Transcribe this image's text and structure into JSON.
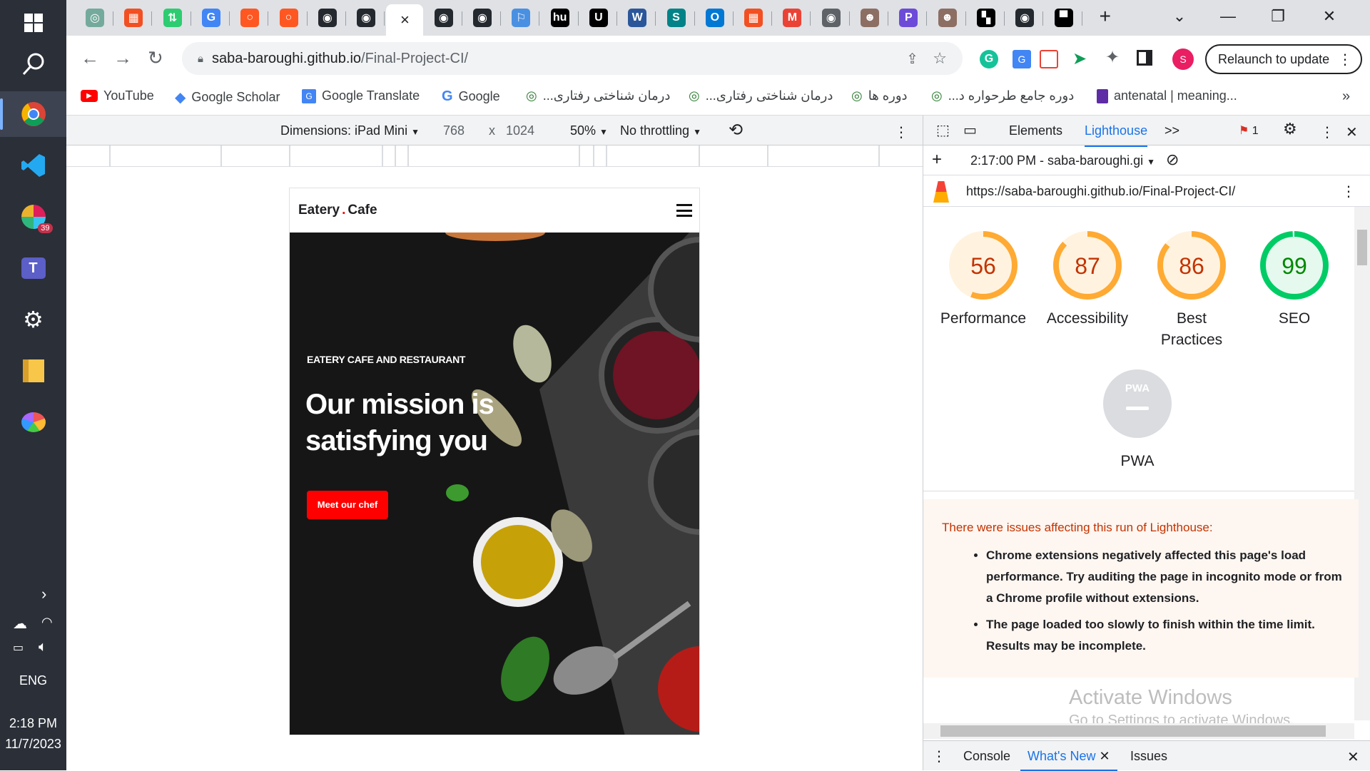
{
  "taskbar": {
    "lang": "ENG",
    "time": "2:18 PM",
    "date": "11/7/2023",
    "slack_badge": "39"
  },
  "tabs": {
    "close_glyph": "×",
    "new_tab": "+",
    "minimize": "—",
    "restore": "❐",
    "close": "✕",
    "favicons": [
      "chatgpt",
      "microsoft",
      "up-down",
      "google-translate",
      "orange-ring",
      "orange-ring",
      "github",
      "github",
      "active",
      "github",
      "github",
      "flag",
      "hu",
      "u",
      "word",
      "sharepoint",
      "outlook",
      "microsoft",
      "gmail",
      "chrome",
      "ninja",
      "p",
      "ninja",
      "bw",
      "github",
      "box"
    ]
  },
  "toolbar": {
    "url_host": "saba-baroughi.github.io",
    "url_path": "/Final-Project-CI/",
    "profile": "S",
    "relaunch": "Relaunch to update"
  },
  "bookmarks": {
    "youtube": "YouTube",
    "scholar": "Google Scholar",
    "translate": "Google Translate",
    "google": "Google",
    "fa1": "درمان شناختی رفتاری...",
    "fa2": "درمان شناختی رفتاری...",
    "fa3": "دوره ها",
    "fa4": "دوره جامع طرحواره د...",
    "antenatal": "antenatal | meaning...",
    "more": "»"
  },
  "device": {
    "dimensions": "Dimensions: iPad Mini",
    "width": "768",
    "x": "x",
    "height": "1024",
    "zoom": "50%",
    "throttling": "No throttling"
  },
  "site": {
    "brand_a": "Eatery",
    "brand_dot": ".",
    "brand_b": "Cafe",
    "eyebrow": "EATERY CAFE AND RESTAURANT",
    "headline_1": "Our mission is",
    "headline_2": "satisfying you",
    "cta": "Meet our chef"
  },
  "devtools": {
    "elements": "Elements",
    "lighthouse": "Lighthouse",
    "more": ">>",
    "issues_count": "1",
    "session": "2:17:00 PM - saba-baroughi.gi",
    "report_url": "https://saba-baroughi.github.io/Final-Project-CI/"
  },
  "scores": [
    {
      "value": 56,
      "label": "Performance",
      "color": "#fa3"
    },
    {
      "value": 87,
      "label": "Accessibility",
      "color": "#fa3"
    },
    {
      "value": 86,
      "label": "Best Practices",
      "color": "#fa3"
    },
    {
      "value": 99,
      "label": "SEO",
      "color": "#0c6"
    }
  ],
  "pwa": {
    "badge": "PWA",
    "label": "PWA"
  },
  "warning": {
    "title": "There were issues affecting this run of Lighthouse:",
    "item1": "Chrome extensions negatively affected this page's load performance. Try auditing the page in incognito mode or from a Chrome profile without extensions.",
    "item2": "The page loaded too slowly to finish within the time limit. Results may be incomplete."
  },
  "watermark": {
    "line1": "Activate Windows",
    "line2": "Go to Settings to activate Windows."
  },
  "drawer": {
    "console": "Console",
    "whats_new": "What's New",
    "issues": "Issues"
  },
  "colors": {
    "brand_red": "#ff0000",
    "lighthouse_blue": "#1a73e8",
    "warning_text": "#c33300"
  }
}
